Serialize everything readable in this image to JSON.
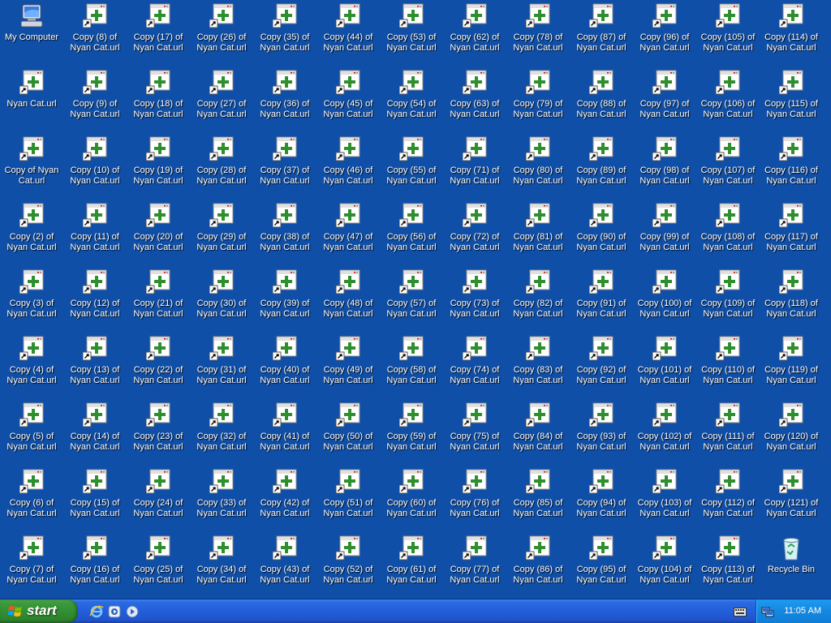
{
  "desktop": {
    "special_icons": {
      "my_computer": "My Computer",
      "recycle_bin": "Recycle Bin"
    },
    "icons_by_column": [
      [
        "My Computer",
        "Nyan Cat.url",
        "Copy of Nyan Cat.url",
        "Copy (2) of Nyan Cat.url",
        "Copy (3) of Nyan Cat.url",
        "Copy (4) of Nyan Cat.url",
        "Copy (5) of Nyan Cat.url",
        "Copy (6) of Nyan Cat.url",
        "Copy (7) of Nyan Cat.url"
      ],
      [
        "Copy (8) of Nyan Cat.url",
        "Copy (9) of Nyan Cat.url",
        "Copy (10) of Nyan Cat.url",
        "Copy (11) of Nyan Cat.url",
        "Copy (12) of Nyan Cat.url",
        "Copy (13) of Nyan Cat.url",
        "Copy (14) of Nyan Cat.url",
        "Copy (15) of Nyan Cat.url",
        "Copy (16) of Nyan Cat.url"
      ],
      [
        "Copy (17) of Nyan Cat.url",
        "Copy (18) of Nyan Cat.url",
        "Copy (19) of Nyan Cat.url",
        "Copy (20) of Nyan Cat.url",
        "Copy (21) of Nyan Cat.url",
        "Copy (22) of Nyan Cat.url",
        "Copy (23) of Nyan Cat.url",
        "Copy (24) of Nyan Cat.url",
        "Copy (25) of Nyan Cat.url"
      ],
      [
        "Copy (26) of Nyan Cat.url",
        "Copy (27) of Nyan Cat.url",
        "Copy (28) of Nyan Cat.url",
        "Copy (29) of Nyan Cat.url",
        "Copy (30) of Nyan Cat.url",
        "Copy (31) of Nyan Cat.url",
        "Copy (32) of Nyan Cat.url",
        "Copy (33) of Nyan Cat.url",
        "Copy (34) of Nyan Cat.url"
      ],
      [
        "Copy (35) of Nyan Cat.url",
        "Copy (36) of Nyan Cat.url",
        "Copy (37) of Nyan Cat.url",
        "Copy (38) of Nyan Cat.url",
        "Copy (39) of Nyan Cat.url",
        "Copy (40) of Nyan Cat.url",
        "Copy (41) of Nyan Cat.url",
        "Copy (42) of Nyan Cat.url",
        "Copy (43) of Nyan Cat.url"
      ],
      [
        "Copy (44) of Nyan Cat.url",
        "Copy (45) of Nyan Cat.url",
        "Copy (46) of Nyan Cat.url",
        "Copy (47) of Nyan Cat.url",
        "Copy (48) of Nyan Cat.url",
        "Copy (49) of Nyan Cat.url",
        "Copy (50) of Nyan Cat.url",
        "Copy (51) of Nyan Cat.url",
        "Copy (52) of Nyan Cat.url"
      ],
      [
        "Copy (53) of Nyan Cat.url",
        "Copy (54) of Nyan Cat.url",
        "Copy (55) of Nyan Cat.url",
        "Copy (56) of Nyan Cat.url",
        "Copy (57) of Nyan Cat.url",
        "Copy (58) of Nyan Cat.url",
        "Copy (59) of Nyan Cat.url",
        "Copy (60) of Nyan Cat.url",
        "Copy (61) of Nyan Cat.url"
      ],
      [
        "Copy (62) of Nyan Cat.url",
        "Copy (63) of Nyan Cat.url",
        "Copy (71) of Nyan Cat.url",
        "Copy (72) of Nyan Cat.url",
        "Copy (73) of Nyan Cat.url",
        "Copy (74) of Nyan Cat.url",
        "Copy (75) of Nyan Cat.url",
        "Copy (76) of Nyan Cat.url",
        "Copy (77) of Nyan Cat.url"
      ],
      [
        "Copy (78) of Nyan Cat.url",
        "Copy (79) of Nyan Cat.url",
        "Copy (80) of Nyan Cat.url",
        "Copy (81) of Nyan Cat.url",
        "Copy (82) of Nyan Cat.url",
        "Copy (83) of Nyan Cat.url",
        "Copy (84) of Nyan Cat.url",
        "Copy (85) of Nyan Cat.url",
        "Copy (86) of Nyan Cat.url"
      ],
      [
        "Copy (87) of Nyan Cat.url",
        "Copy (88) of Nyan Cat.url",
        "Copy (89) of Nyan Cat.url",
        "Copy (90) of Nyan Cat.url",
        "Copy (91) of Nyan Cat.url",
        "Copy (92) of Nyan Cat.url",
        "Copy (93) of Nyan Cat.url",
        "Copy (94) of Nyan Cat.url",
        "Copy (95) of Nyan Cat.url"
      ],
      [
        "Copy (96) of Nyan Cat.url",
        "Copy (97) of Nyan Cat.url",
        "Copy (98) of Nyan Cat.url",
        "Copy (99) of Nyan Cat.url",
        "Copy (100) of Nyan Cat.url",
        "Copy (101) of Nyan Cat.url",
        "Copy (102) of Nyan Cat.url",
        "Copy (103) of Nyan Cat.url",
        "Copy (104) of Nyan Cat.url"
      ],
      [
        "Copy (105) of Nyan Cat.url",
        "Copy (106) of Nyan Cat.url",
        "Copy (107) of Nyan Cat.url",
        "Copy (108) of Nyan Cat.url",
        "Copy (109) of Nyan Cat.url",
        "Copy (110) of Nyan Cat.url",
        "Copy (111) of Nyan Cat.url",
        "Copy (112) of Nyan Cat.url",
        "Copy (113) of Nyan Cat.url"
      ],
      [
        "Copy (114) of Nyan Cat.url",
        "Copy (115) of Nyan Cat.url",
        "Copy (116) of Nyan Cat.url",
        "Copy (117) of Nyan Cat.url",
        "Copy (118) of Nyan Cat.url",
        "Copy (119) of Nyan Cat.url",
        "Copy (120) of Nyan Cat.url",
        "Copy (121) of Nyan Cat.url",
        "Recycle Bin"
      ]
    ],
    "icon_kinds": {
      "my_computer": "computer-icon",
      "url": "internet-shortcut-icon",
      "recycle_bin": "recycle-bin-icon"
    },
    "colors": {
      "background": "#0f4fa8",
      "label_text": "#ffffff"
    }
  },
  "taskbar": {
    "start_label": "start",
    "quick_launch": [
      "internet-explorer-icon",
      "media-player-icon",
      "windows-update-icon"
    ],
    "tray": {
      "clock": "11:05 AM",
      "icons": [
        "network-icon",
        "keyboard-icon"
      ]
    },
    "colors": {
      "taskbar": "#245edb",
      "start_button": "#338f33",
      "tray": "#1488e0"
    }
  }
}
